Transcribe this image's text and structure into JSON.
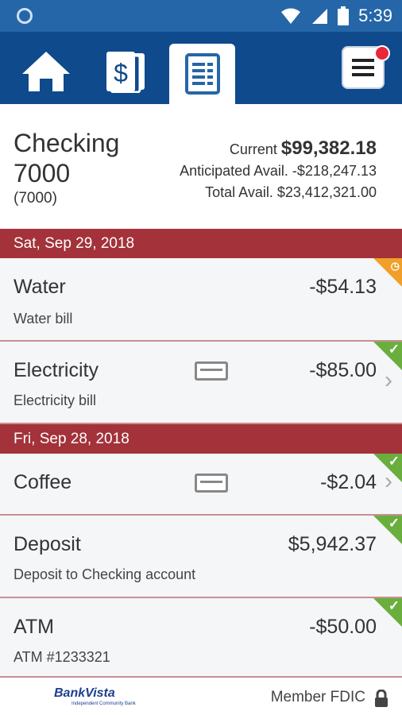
{
  "status_bar": {
    "time": "5:39"
  },
  "nav": {
    "tabs": [
      {
        "icon": "home-icon"
      },
      {
        "icon": "accounts-dollar-icon"
      },
      {
        "icon": "transactions-list-icon"
      }
    ],
    "menu_icon": "hamburger-menu-icon"
  },
  "account": {
    "name": "Checking 7000",
    "number": "(7000)",
    "current_label": "Current",
    "current_value": "$99,382.18",
    "anticipated_label": "Anticipated Avail.",
    "anticipated_value": "-$218,247.13",
    "total_label": "Total Avail.",
    "total_value": "$23,412,321.00"
  },
  "groups": [
    {
      "date": "Sat, Sep 29, 2018",
      "transactions": [
        {
          "name": "Water",
          "description": "Water bill",
          "amount": "-$54.13"
        },
        {
          "name": "Electricity",
          "description": "Electricity bill",
          "amount": "-$85.00"
        }
      ]
    },
    {
      "date": "Fri, Sep 28, 2018",
      "transactions": [
        {
          "name": "Coffee",
          "description": "",
          "amount": "-$2.04"
        },
        {
          "name": "Deposit",
          "description": "Deposit to Checking account",
          "amount": "$5,942.37"
        },
        {
          "name": "ATM",
          "description": "ATM #1233321",
          "amount": "-$50.00"
        }
      ]
    }
  ],
  "footer": {
    "logo_text": "BankVista",
    "logo_tagline": "Independent Community Bank",
    "member_text": "Member FDIC"
  },
  "colors": {
    "nav_blue": "#0e4a8c",
    "status_blue": "#2566a8",
    "date_red": "#a3323a",
    "cleared_green": "#6aae3e",
    "pending_orange": "#f0a02a"
  }
}
